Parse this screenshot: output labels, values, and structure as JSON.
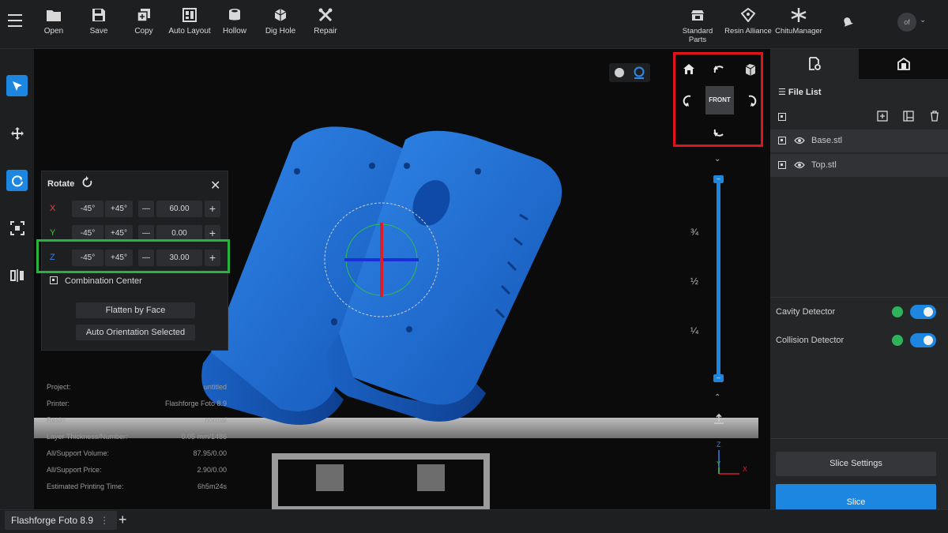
{
  "toolbar": {
    "tools": [
      {
        "label": "Open",
        "icon": "folder-icon"
      },
      {
        "label": "Save",
        "icon": "save-icon"
      },
      {
        "label": "Copy",
        "icon": "copy-icon"
      },
      {
        "label": "Auto Layout",
        "icon": "auto-layout-icon"
      },
      {
        "label": "Hollow",
        "icon": "hollow-icon"
      },
      {
        "label": "Dig Hole",
        "icon": "dig-hole-icon"
      },
      {
        "label": "Repair",
        "icon": "repair-icon"
      }
    ],
    "right_tools": [
      {
        "label": "Standard Parts",
        "icon": "standard-parts-icon"
      },
      {
        "label": "Resin Alliance",
        "icon": "resin-alliance-icon"
      },
      {
        "label": "ChituManager",
        "icon": "chitumanager-icon"
      }
    ],
    "avatar_text": "of"
  },
  "rotate_panel": {
    "title": "Rotate",
    "axes": [
      {
        "axis": "X",
        "minus": "-45°",
        "plus": "+45°",
        "value": "60.00",
        "color": "#e0453e"
      },
      {
        "axis": "Y",
        "minus": "-45°",
        "plus": "+45°",
        "value": "0.00",
        "color": "#3fbf3f"
      },
      {
        "axis": "Z",
        "minus": "-45°",
        "plus": "+45°",
        "value": "30.00",
        "color": "#3a7ee8"
      }
    ],
    "combination_center": "Combination Center",
    "flatten_by_face": "Flatten by Face",
    "auto_orientation": "Auto Orientation Selected"
  },
  "info": [
    {
      "label": "Project:",
      "value": "untitled"
    },
    {
      "label": "Printer:",
      "value": "Flashforge Foto 8.9"
    },
    {
      "label": "Resin:",
      "value": "normal"
    },
    {
      "label": "Layer Thickness/Number:",
      "value": "0.05 mm/1486"
    },
    {
      "label": "All/Support Volume:",
      "value": "87.95/0.00"
    },
    {
      "label": "All/Support Price:",
      "value": "2.90/0.00"
    },
    {
      "label": "Estimated Printing Time:",
      "value": "6h5m24s"
    }
  ],
  "view_nav": {
    "front_label": "FRONT"
  },
  "layer_slider": {
    "fractions": [
      "¾",
      "½",
      "¼"
    ],
    "top_level": 1.0,
    "bottom_level": 0.0
  },
  "axis_gizmo": {
    "x": "X",
    "y": "Y",
    "z": "Z"
  },
  "file_list": {
    "title": "File List",
    "files": [
      {
        "name": "Base.stl"
      },
      {
        "name": "Top.stl"
      }
    ]
  },
  "detectors": [
    {
      "label": "Cavity Detector",
      "enabled": true
    },
    {
      "label": "Collision Detector",
      "enabled": true
    }
  ],
  "slice_settings": "Slice Settings",
  "slice": "Slice",
  "printer_tab": {
    "name": "Flashforge Foto 8.9",
    "add": "+"
  }
}
